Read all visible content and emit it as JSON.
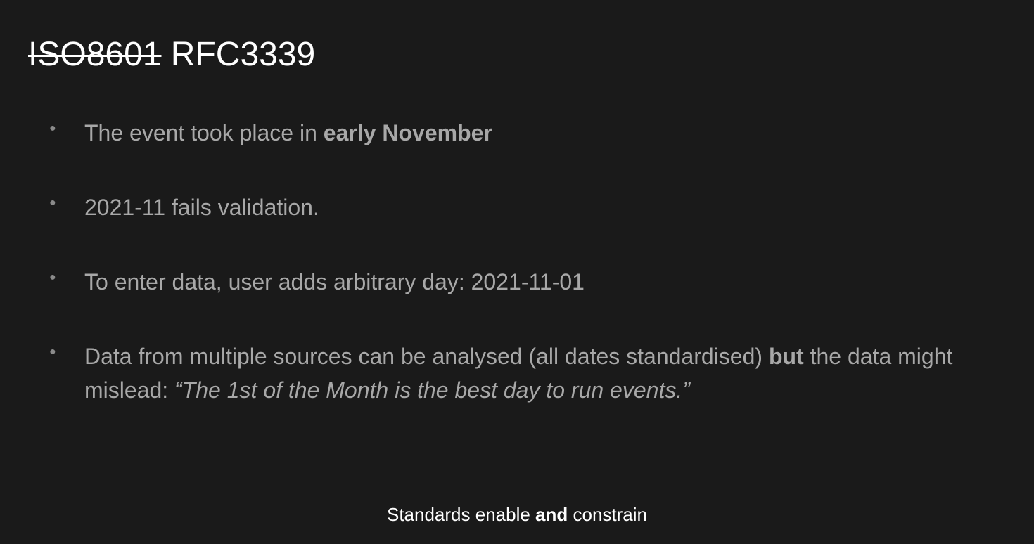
{
  "title": {
    "struck": "ISO8601",
    "rest": " RFC3339"
  },
  "bullets": {
    "b1a": "The event took place in ",
    "b1b": "early November",
    "b2": "2021-11 fails validation.",
    "b3": "To enter data, user adds arbitrary day: 2021-11-01",
    "b4a": "Data from multiple sources can be analysed (all dates standardised) ",
    "b4b": "but",
    "b4c": " the data might mislead: ",
    "b4d": "“The 1st of the Month is the best day to run events.”"
  },
  "footer": {
    "a": "Standards enable ",
    "b": "and",
    "c": " constrain"
  }
}
